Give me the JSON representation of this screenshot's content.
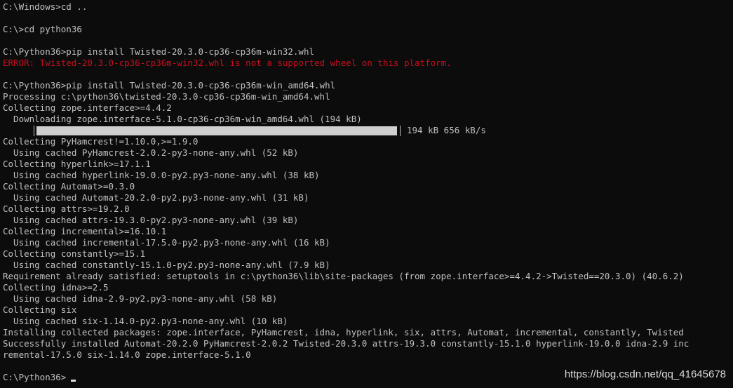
{
  "console": {
    "lines": [
      "C:\\Windows>cd ..",
      "",
      "C:\\>cd python36",
      "",
      "C:\\Python36>pip install Twisted-20.3.0-cp36-cp36m-win32.whl",
      "ERROR: Twisted-20.3.0-cp36-cp36m-win32.whl is not a supported wheel on this platform.",
      "",
      "C:\\Python36>pip install Twisted-20.3.0-cp36-cp36m-win_amd64.whl",
      "Processing c:\\python36\\twisted-20.3.0-cp36-cp36m-win_amd64.whl",
      "Collecting zope.interface>=4.4.2",
      "  Downloading zope.interface-5.1.0-cp36-cp36m-win_amd64.whl (194 kB)",
      "",
      "Collecting PyHamcrest!=1.10.0,>=1.9.0",
      "  Using cached PyHamcrest-2.0.2-py3-none-any.whl (52 kB)",
      "Collecting hyperlink>=17.1.1",
      "  Using cached hyperlink-19.0.0-py2.py3-none-any.whl (38 kB)",
      "Collecting Automat>=0.3.0",
      "  Using cached Automat-20.2.0-py2.py3-none-any.whl (31 kB)",
      "Collecting attrs>=19.2.0",
      "  Using cached attrs-19.3.0-py2.py3-none-any.whl (39 kB)",
      "Collecting incremental>=16.10.1",
      "  Using cached incremental-17.5.0-py2.py3-none-any.whl (16 kB)",
      "Collecting constantly>=15.1",
      "  Using cached constantly-15.1.0-py2.py3-none-any.whl (7.9 kB)",
      "Requirement already satisfied: setuptools in c:\\python36\\lib\\site-packages (from zope.interface>=4.4.2->Twisted==20.3.0) (40.6.2)",
      "Collecting idna>=2.5",
      "  Using cached idna-2.9-py2.py3-none-any.whl (58 kB)",
      "Collecting six",
      "  Using cached six-1.14.0-py2.py3-none-any.whl (10 kB)",
      "Installing collected packages: zope.interface, PyHamcrest, idna, hyperlink, six, attrs, Automat, incremental, constantly, Twisted",
      "Successfully installed Automat-20.2.0 PyHamcrest-2.0.2 Twisted-20.3.0 attrs-19.3.0 constantly-15.1.0 hyperlink-19.0.0 idna-2.9 inc",
      "remental-17.5.0 six-1.14.0 zope.interface-5.1.0",
      "",
      "C:\\Python36>"
    ],
    "error_line_index": 5,
    "progress_line_index": 11,
    "progress": {
      "fraction": 1.0,
      "stats": "194 kB 656 kB/s"
    },
    "colors": {
      "background": "#0c0c0c",
      "text": "#c0c0c0",
      "error": "#c50f1f"
    }
  },
  "watermark": "https://blog.csdn.net/qq_41645678"
}
